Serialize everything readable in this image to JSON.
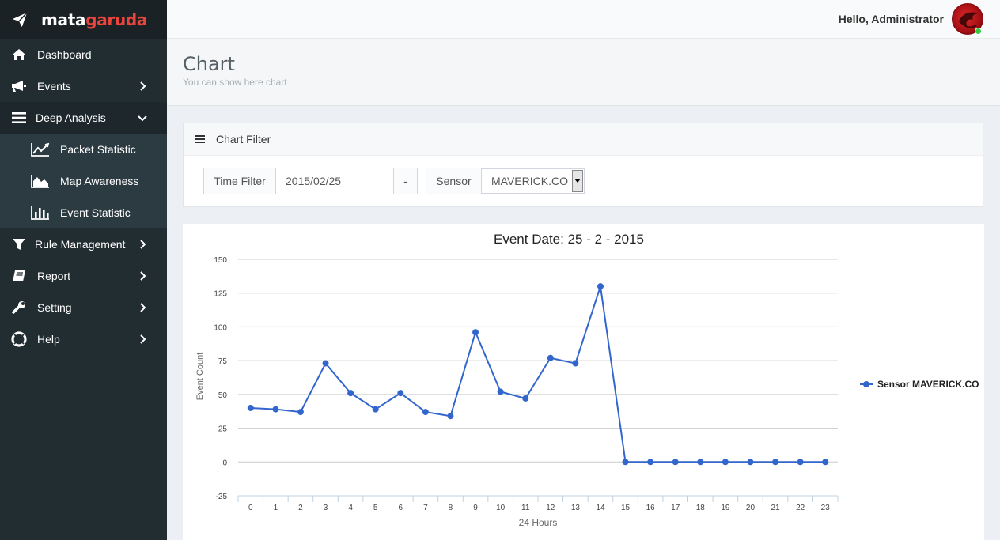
{
  "brand": {
    "text_primary": "mata",
    "text_accent": "garuda",
    "accent_color": "#e8453c",
    "icon": "paper-plane-icon"
  },
  "sidebar": {
    "items": [
      {
        "label": "Dashboard",
        "icon": "home-icon"
      },
      {
        "label": "Events",
        "icon": "bullhorn-icon"
      },
      {
        "label": "Deep Analysis",
        "icon": "bars-icon",
        "open": true,
        "children": [
          {
            "label": "Packet Statistic",
            "icon": "line-chart-icon"
          },
          {
            "label": "Map Awareness",
            "icon": "area-chart-icon"
          },
          {
            "label": "Event Statistic",
            "icon": "bar-chart-icon"
          }
        ]
      },
      {
        "label": "Rule Management",
        "icon": "filter-icon"
      },
      {
        "label": "Report",
        "icon": "book-icon"
      },
      {
        "label": "Setting",
        "icon": "wrench-icon"
      },
      {
        "label": "Help",
        "icon": "life-ring-icon"
      }
    ]
  },
  "header": {
    "greeting": "Hello, Administrator",
    "status_color": "#2ecc40"
  },
  "page": {
    "title": "Chart",
    "subtitle": "You can show here chart"
  },
  "filter": {
    "title": "Chart Filter",
    "time_filter_label": "Time Filter",
    "time_filter_value": "2015/02/25",
    "separator": "-",
    "sensor_label": "Sensor",
    "sensor_value": "MAVERICK.CO"
  },
  "chart_data": {
    "type": "line",
    "title": "Event Date: 25 - 2 - 2015",
    "xlabel": "24 Hours",
    "ylabel": "Event Count",
    "x": [
      "0",
      "1",
      "2",
      "3",
      "4",
      "5",
      "6",
      "7",
      "8",
      "9",
      "10",
      "11",
      "12",
      "13",
      "14",
      "15",
      "16",
      "17",
      "18",
      "19",
      "20",
      "21",
      "22",
      "23"
    ],
    "series": [
      {
        "name": "Sensor MAVERICK.CO",
        "color": "#3366cc",
        "values": [
          40,
          39,
          37,
          73,
          51,
          39,
          51,
          37,
          34,
          96,
          52,
          47,
          77,
          73,
          130,
          0,
          0,
          0,
          0,
          0,
          0,
          0,
          0,
          0
        ]
      }
    ],
    "ylim": [
      -25,
      150
    ],
    "yticks": [
      150,
      125,
      100,
      75,
      50,
      25,
      0,
      -25
    ],
    "grid": true,
    "legend": "right"
  }
}
